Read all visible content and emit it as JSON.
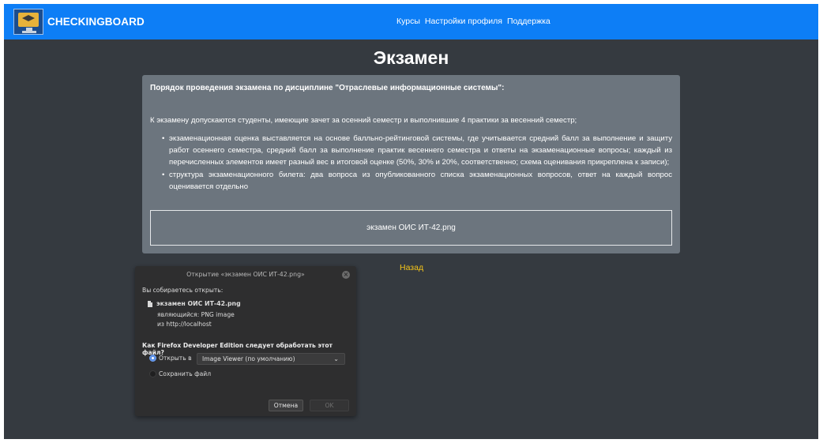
{
  "navbar": {
    "brand": "CHECKINGBOARD",
    "links": [
      "Курсы",
      "Настройки профиля",
      "Поддержка"
    ]
  },
  "page": {
    "title": "Экзамен"
  },
  "card": {
    "heading": "Порядок проведения экзамена по дисциплине \"Отраслевые информационные системы\":",
    "intro": "К экзамену допускаются студенты, имеющие зачет за осенний семестр и выполнившие 4 практики за весенний семестр;",
    "items": [
      "экзаменационная оценка выставляется на основе балльно-рейтинговой системы, где учитывается средний балл за выполнение и защиту работ осеннего семестра, средний балл за выполнение практик весеннего семестра и ответы на экзаменационные вопросы; каждый из перечисленных элементов имеет разный вес в итоговой оценке (50%, 30% и 20%, соответственно; схема оценивания прикреплена к записи);",
      "структура экзаменационного билета: два вопроса из опубликованного списка экзаменационных вопросов, ответ на каждый вопрос оценивается отдельно"
    ],
    "attachment": "экзамен ОИС ИТ-42.png"
  },
  "back_link": "Назад",
  "dialog": {
    "title": "Открытие «экзамен ОИС ИТ-42.png»",
    "prompt": "Вы собираетесь открыть:",
    "filename": "экзамен ОИС ИТ-42.png",
    "type_label": "являющийся:",
    "type_value": "PNG image",
    "from_label": "из",
    "from_value": "http://localhost",
    "question": "Как Firefox Developer Edition следует обработать этот файл?",
    "open_with_label": "Открыть в",
    "open_with_selected": "Image Viewer (по умолчанию)",
    "save_label": "Сохранить файл",
    "cancel_button": "Отмена",
    "ok_button": "OK"
  }
}
